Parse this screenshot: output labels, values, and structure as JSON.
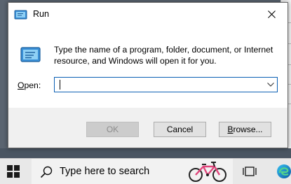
{
  "window": {
    "title": "Run",
    "description": "Type the name of a program, folder, document, or Internet resource, and Windows will open it for you.",
    "open_label_mnemonic": "O",
    "open_label_rest": "pen:",
    "open_value": ""
  },
  "buttons": {
    "ok": "OK",
    "cancel": "Cancel",
    "browse_mnemonic": "B",
    "browse_rest": "rowse..."
  },
  "taskbar": {
    "search_placeholder": "Type here to search"
  },
  "icons": [
    "run-icon",
    "close-icon",
    "chevron-down-icon",
    "windows-start-icon",
    "search-icon",
    "bike-icon",
    "task-view-icon",
    "edge-icon"
  ],
  "colors": {
    "accent_border": "#0a5fb4",
    "dialog_bg": "#f0f0f0",
    "taskbar_bg": "#e8e8e8"
  }
}
